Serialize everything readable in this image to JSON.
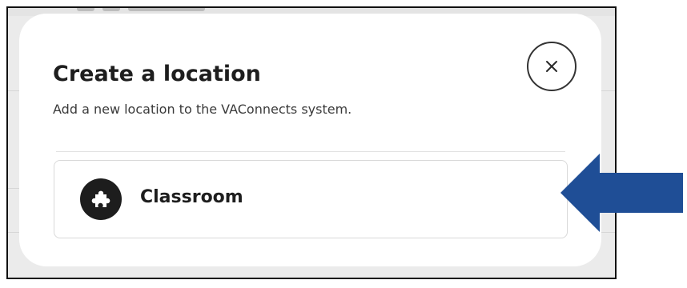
{
  "modal": {
    "title": "Create a location",
    "subtitle": "Add a new location to the VAConnects system.",
    "close_icon": "close-icon"
  },
  "options": [
    {
      "label": "Classroom",
      "icon": "puzzle-piece-icon"
    }
  ],
  "annotation": {
    "arrow_icon": "left-arrow-pointer",
    "arrow_color": "#1f4e96"
  },
  "colors": {
    "backdrop": "#ebebeb",
    "modal_background": "#ffffff",
    "text_primary": "#1e1e1e",
    "icon_background": "#1d1d1d",
    "frame_border": "#111111"
  }
}
